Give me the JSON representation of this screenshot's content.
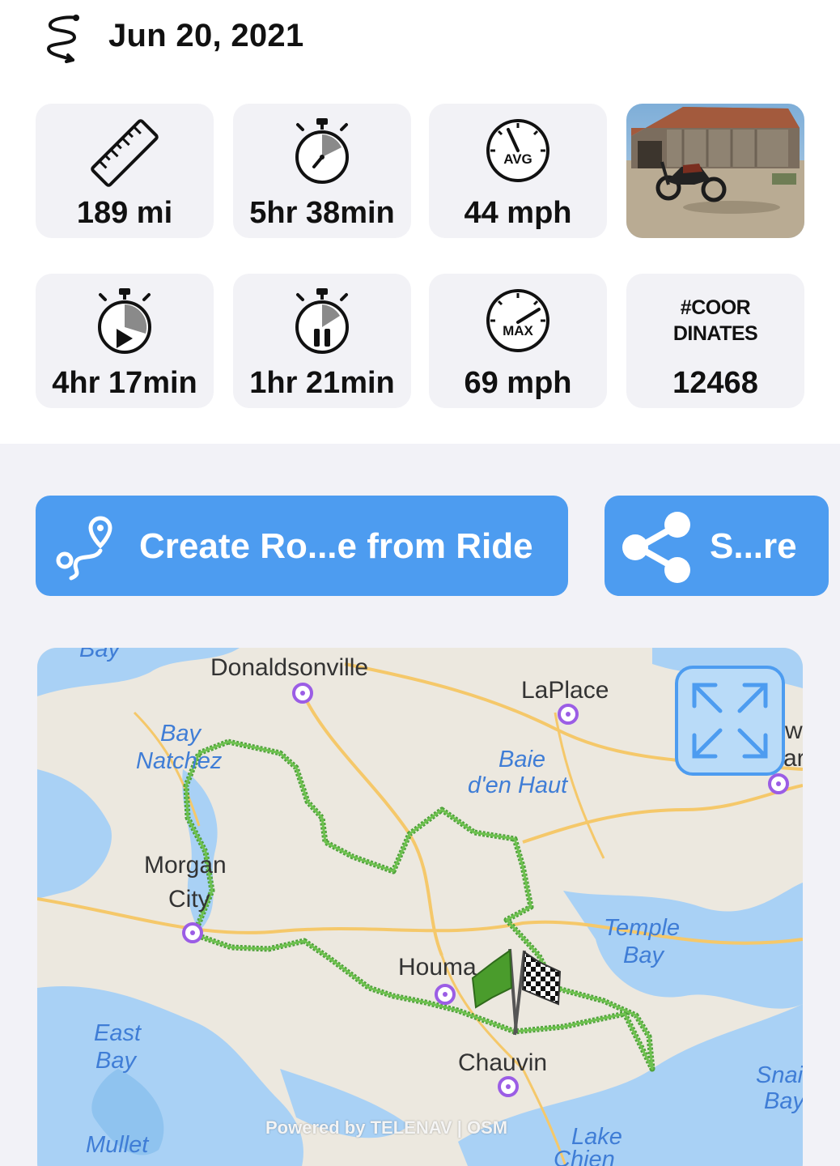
{
  "header": {
    "date": "Jun 20, 2021",
    "icon": "route-squiggle-icon"
  },
  "stats": {
    "distance": {
      "icon": "ruler-icon",
      "value": "189 mi"
    },
    "total_time": {
      "icon": "stopwatch-icon",
      "value": "5hr 38min"
    },
    "avg_speed": {
      "icon": "avg-speedometer-icon",
      "icon_text": "AVG",
      "value": "44 mph"
    },
    "moving_time": {
      "icon": "stopwatch-play-icon",
      "value": "4hr 17min"
    },
    "paused_time": {
      "icon": "stopwatch-pause-icon",
      "value": "1hr 21min"
    },
    "max_speed": {
      "icon": "max-speedometer-icon",
      "icon_text": "MAX",
      "value": "69 mph"
    },
    "coordinates": {
      "label_line1": "#COOR",
      "label_line2": "DINATES",
      "value": "12468"
    },
    "photo": {
      "description": "motorcycle-photo"
    }
  },
  "actions": {
    "create_route": {
      "icon": "route-pin-icon",
      "label": "Create Ro...e from Ride"
    },
    "share": {
      "icon": "share-icon",
      "label": "S...re"
    }
  },
  "map": {
    "places": {
      "donaldsonville": "Donaldsonville",
      "laplace": "LaPlace",
      "morgan_line1": "Morgan",
      "morgan_line2": "City",
      "houma": "Houma",
      "chauvin": "Chauvin",
      "new_orleans_partial_1": "w",
      "new_orleans_partial_2": "ar"
    },
    "water": {
      "bay_natchez_1": "Bay",
      "bay_natchez_2": "Natchez",
      "baie_1": "Baie",
      "baie_2": "d'en Haut",
      "temple_1": "Temple",
      "temple_2": "Bay",
      "east_1": "East",
      "east_2": "Bay",
      "snail_1": "Snai",
      "snail_2": "Bay",
      "mullet": "Mullet",
      "lake_1": "Lake",
      "lake_2": "Chien",
      "top_partial": "Bay"
    },
    "attribution": "Powered by TELENAV | OSM",
    "expand_icon": "expand-arrows-icon",
    "start_flag_icon": "green-flag-icon",
    "finish_flag_icon": "checkered-flag-icon",
    "colors": {
      "track": "#4fa23a",
      "water": "#a9d1f5",
      "land": "#ece8df",
      "road": "#f5c86a",
      "pin": "#9b5de5",
      "button": "#4d9cf0"
    }
  }
}
